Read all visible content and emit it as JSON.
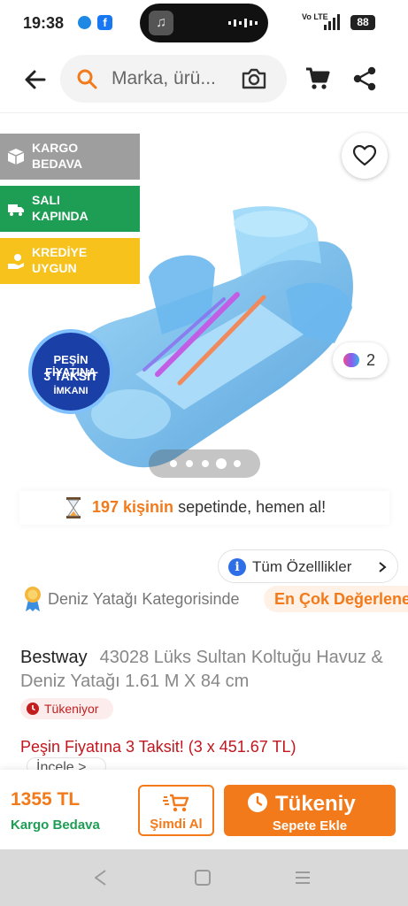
{
  "status_bar": {
    "time": "19:38",
    "network": "Vo LTE",
    "battery": "88",
    "icons": [
      "messenger-icon",
      "facebook-icon",
      "music-icon",
      "signal-icon",
      "battery-icon"
    ]
  },
  "header": {
    "search_placeholder": "Marka, ürü...",
    "icons": [
      "back-arrow-icon",
      "search-icon",
      "camera-icon",
      "cart-icon",
      "share-icon"
    ]
  },
  "badges": [
    {
      "line1": "KARGO",
      "line2": "BEDAVA",
      "color": "#9e9e9e",
      "icon": "box-icon"
    },
    {
      "line1": "SALI",
      "line2": "KAPINDA",
      "color": "#1e9e54",
      "icon": "truck-icon"
    },
    {
      "line1": "KREDİYE",
      "line2": "UYGUN",
      "color": "#f6c21b",
      "icon": "money-icon"
    }
  ],
  "promo_seal": {
    "line1": "PEŞİN FİYATINA",
    "line2": "3 TAKSİT",
    "line3": "İMKANI"
  },
  "gallery": {
    "color_count": "2",
    "image_count": 5,
    "active_image": 4
  },
  "cart_notice": {
    "count_text": "197 kişinin",
    "rest_text": " sepetinde, hemen al!"
  },
  "features": {
    "all_label": "Tüm Özelllikler"
  },
  "category": {
    "text": "Deniz Yatağı Kategorisinde",
    "badge": "En Çok Değerlene"
  },
  "product": {
    "brand": "Bestway",
    "name": "43028 Lüks Sultan Koltuğu Havuz & Deniz Yatağı 1.61 M X 84 cm",
    "stock_label": "Tükeniyor",
    "installment_text": "Peşin Fiyatına 3 Taksit! (3 x 451.67 TL)",
    "review_peek": "İncele >"
  },
  "buy_bar": {
    "price": "1355 TL",
    "shipping": "Kargo Bedava",
    "buy_now_label": "Şimdi Al",
    "add_line1": "Tükeniy",
    "add_line2": "Sepete Ekle"
  },
  "colors": {
    "accent": "#f27a1a",
    "green": "#1e9e54",
    "danger": "#c2161e"
  }
}
